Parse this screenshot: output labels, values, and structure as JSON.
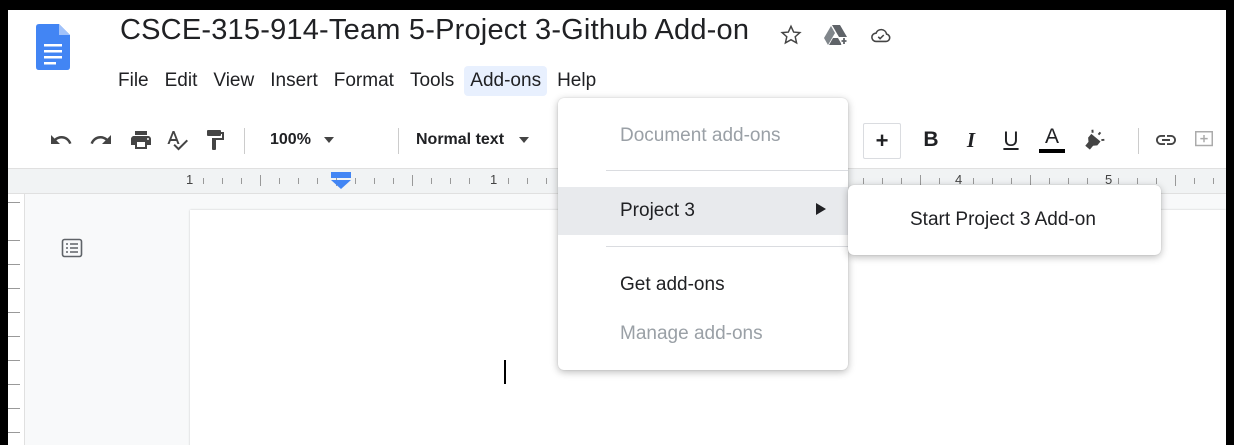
{
  "document": {
    "title": "CSCE-315-914-Team 5-Project 3-Github Add-on"
  },
  "title_icons": [
    "star-icon",
    "drive-move-icon",
    "cloud-saved-icon"
  ],
  "menubar": {
    "items": [
      {
        "label": "File"
      },
      {
        "label": "Edit"
      },
      {
        "label": "View"
      },
      {
        "label": "Insert"
      },
      {
        "label": "Format"
      },
      {
        "label": "Tools"
      },
      {
        "label": "Add-ons",
        "active": true
      },
      {
        "label": "Help"
      }
    ]
  },
  "toolbar": {
    "zoom": "100%",
    "style": "Normal text",
    "bold": "B",
    "italic": "I",
    "underline": "U",
    "text_color": "A",
    "increase_size": "+"
  },
  "ruler": {
    "numbers": [
      "1",
      "1",
      "4",
      "5"
    ]
  },
  "addons_menu": {
    "items": [
      {
        "label": "Document add-ons",
        "disabled": true
      },
      {
        "label": "Project 3",
        "has_submenu": true,
        "hovered": true
      },
      {
        "label": "Get add-ons"
      },
      {
        "label": "Manage add-ons",
        "disabled": true
      }
    ],
    "submenu": {
      "items": [
        {
          "label": "Start Project 3 Add-on"
        }
      ]
    }
  },
  "colors": {
    "docs_blue": "#4285f4",
    "menu_active_bg": "#e8f0fe",
    "disabled_text": "#9aa0a6"
  }
}
